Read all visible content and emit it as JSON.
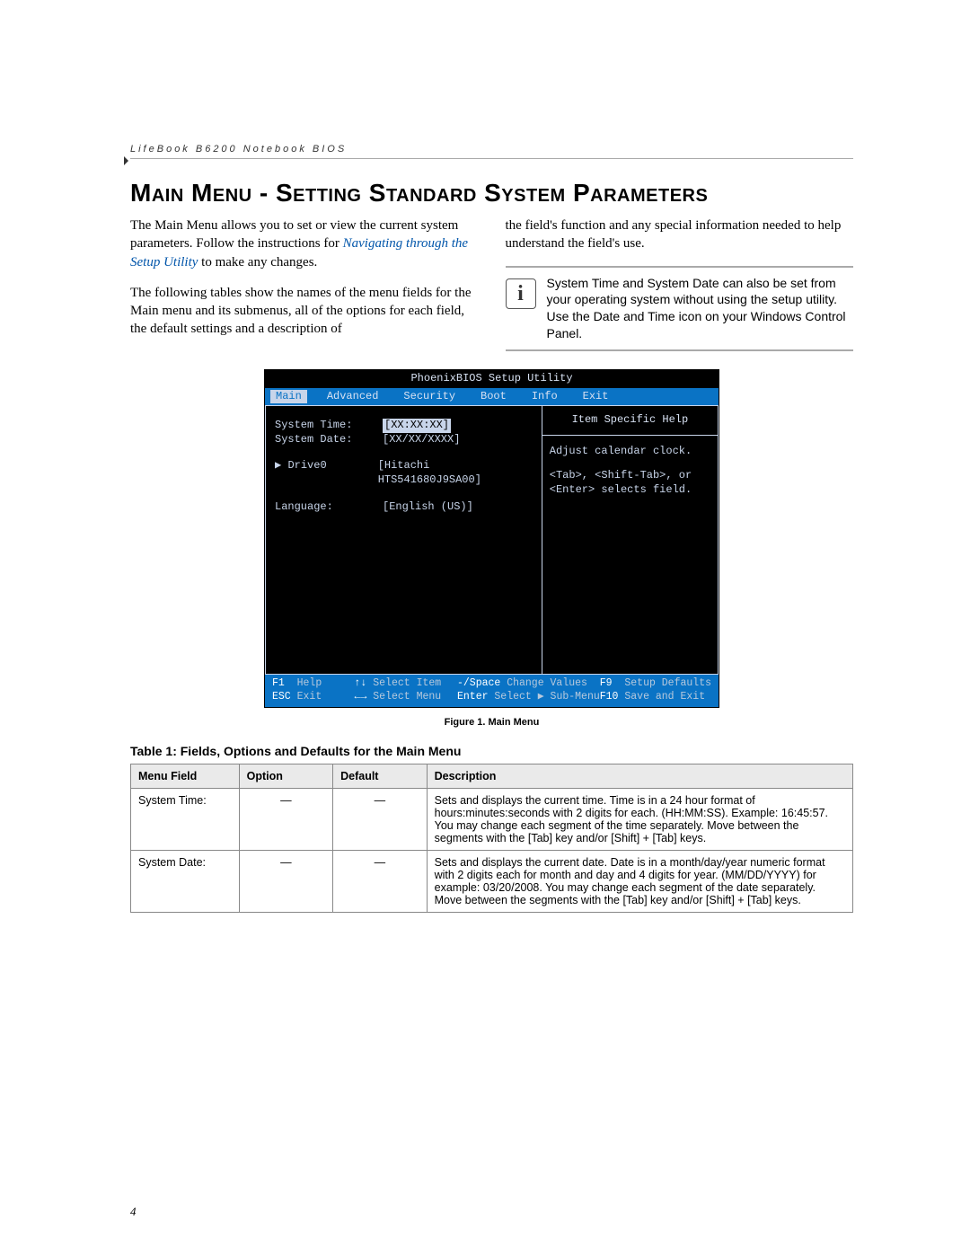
{
  "header": "LifeBook B6200 Notebook BIOS",
  "title": "Main Menu - Setting Standard System Parameters",
  "para1a": "The Main Menu allows you to set or view the current system parameters. Follow the instructions for ",
  "para1_link": "Navigating through the Setup Utility",
  "para1b": " to make any changes.",
  "para2": "The following tables show the names of the menu fields for the Main menu and its submenus, all of the options for each field, the default settings and a description of",
  "para3": "the field's function and any special information needed to help understand the field's use.",
  "info_note": "System Time and System Date can also be set from your operating system without using the setup utility. Use the Date and Time icon on your Windows Control Panel.",
  "bios": {
    "title": "PhoenixBIOS Setup Utility",
    "tabs": [
      "Main",
      "Advanced",
      "Security",
      "Boot",
      "Info",
      "Exit"
    ],
    "rows": {
      "system_time_label": "System Time:",
      "system_time_val": "[XX:XX:XX]",
      "system_date_label": "System Date:",
      "system_date_val": "[XX/XX/XXXX]",
      "drive0_label": "Drive0",
      "drive0_val": "[Hitachi HTS541680J9SA00]",
      "language_label": "Language:",
      "language_val": "[English (US)]"
    },
    "help_title": "Item Specific Help",
    "help_body1": "Adjust calendar clock.",
    "help_body2": "<Tab>, <Shift-Tab>, or <Enter> selects field.",
    "footer": {
      "f1": "F1",
      "help": "Help",
      "sel_item": "Select Item",
      "change_vals_k": "-/Space",
      "change_vals": "Change Values",
      "f9": "F9",
      "setup_def": "Setup Defaults",
      "esc": "ESC",
      "exit": "Exit",
      "sel_menu": "Select Menu",
      "enter": "Enter",
      "select_sub": "Select ▶ Sub-Menu",
      "f10": "F10",
      "save_exit": "Save and Exit"
    }
  },
  "figure_caption": "Figure 1.  Main Menu",
  "table_caption": "Table 1: Fields, Options and Defaults for the Main Menu",
  "table": {
    "headers": [
      "Menu Field",
      "Option",
      "Default",
      "Description"
    ],
    "rows": [
      {
        "field": "System Time:",
        "option": "—",
        "default": "—",
        "desc": "Sets and displays the current time. Time is in a 24 hour format of hours:minutes:seconds with 2 digits for each. (HH:MM:SS). Example: 16:45:57. You may change each segment of the time separately. Move between the segments with the [Tab] key and/or [Shift] + [Tab] keys."
      },
      {
        "field": "System Date:",
        "option": "—",
        "default": "—",
        "desc": "Sets and displays the current date. Date is in a month/day/year numeric format with 2 digits each for month and day and 4 digits for year. (MM/DD/YYYY) for example: 03/20/2008. You may change each segment of the date separately. Move between the segments with the [Tab] key and/or [Shift] + [Tab] keys."
      }
    ]
  },
  "page_number": "4"
}
